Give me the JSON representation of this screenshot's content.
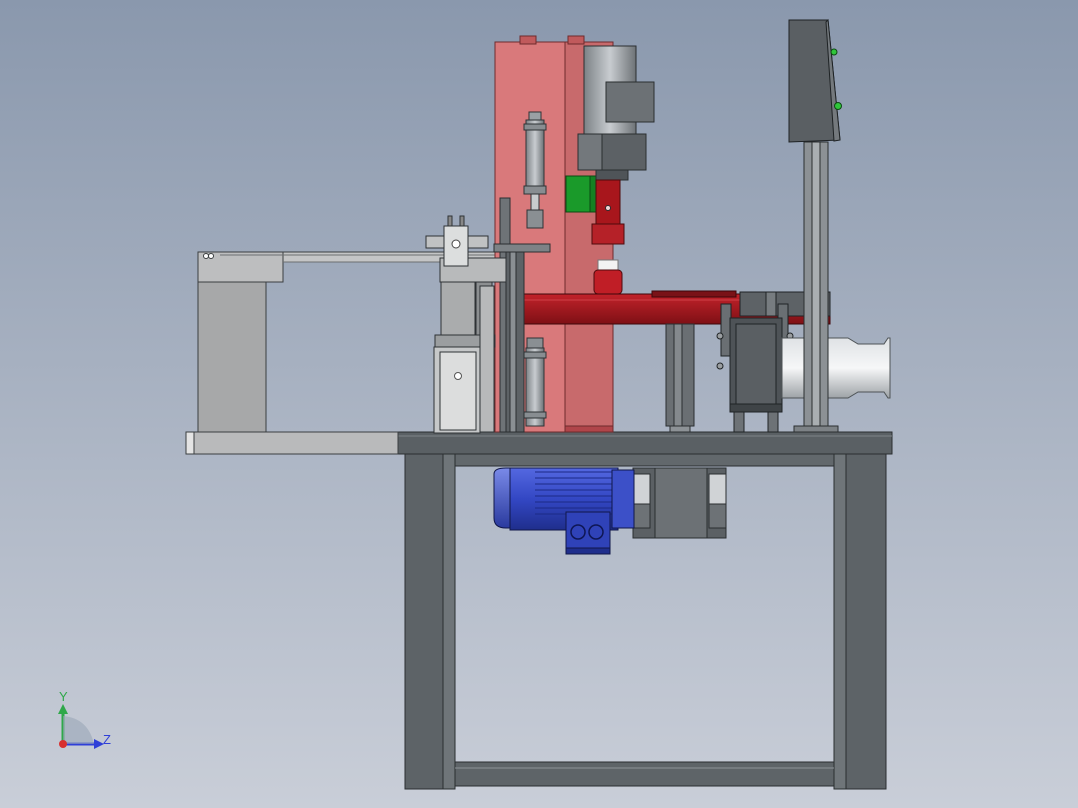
{
  "viewport": {
    "background_top": "#8a98ad",
    "background_bottom": "#c9ced8"
  },
  "triad": {
    "y_label": "Y",
    "z_label": "Z",
    "y_color": "#2fa84a",
    "z_color": "#2f3fd8",
    "x_color": "#d83030"
  },
  "colors": {
    "frame": "#5e6468",
    "frame_edge": "#2e3235",
    "plate": "#5a6064",
    "housing": "#d9787a",
    "housing_side": "#c86c6e",
    "arm": "#a4161c",
    "motor": "#3a4fc8",
    "motor_dark": "#24369a",
    "gray_part": "#a8a8a8",
    "dark_part": "#4a4f52",
    "green": "#1a9a2a",
    "cylinder": "#c2c6c9"
  }
}
